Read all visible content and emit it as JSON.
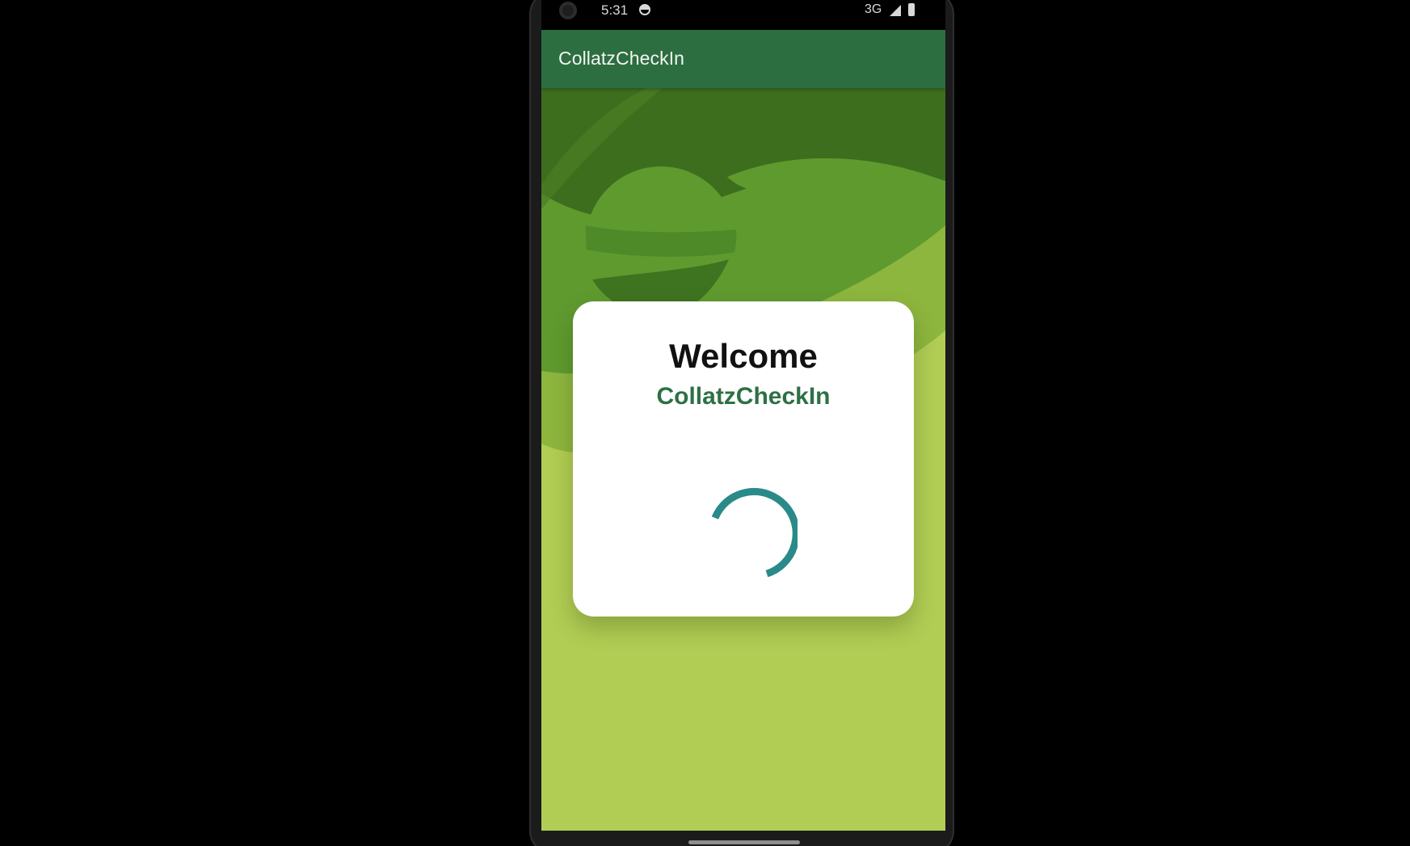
{
  "status_bar": {
    "time": "5:31",
    "network": "3G",
    "icons": [
      "camera-icon",
      "sim-icon",
      "signal-icon",
      "battery-icon"
    ]
  },
  "app_bar": {
    "title": "CollatzCheckIn",
    "color": "#2c6e3f"
  },
  "card": {
    "welcome": "Welcome",
    "app_name": "CollatzCheckIn",
    "app_name_color": "#2e7044",
    "spinner_color": "#2a8a8a",
    "spinner_icon": "loading-spinner-icon"
  },
  "colors": {
    "bg_dark": "#3d6e1e",
    "bg_mid": "#5f9a2f",
    "bg_light": "#b2cd54"
  }
}
